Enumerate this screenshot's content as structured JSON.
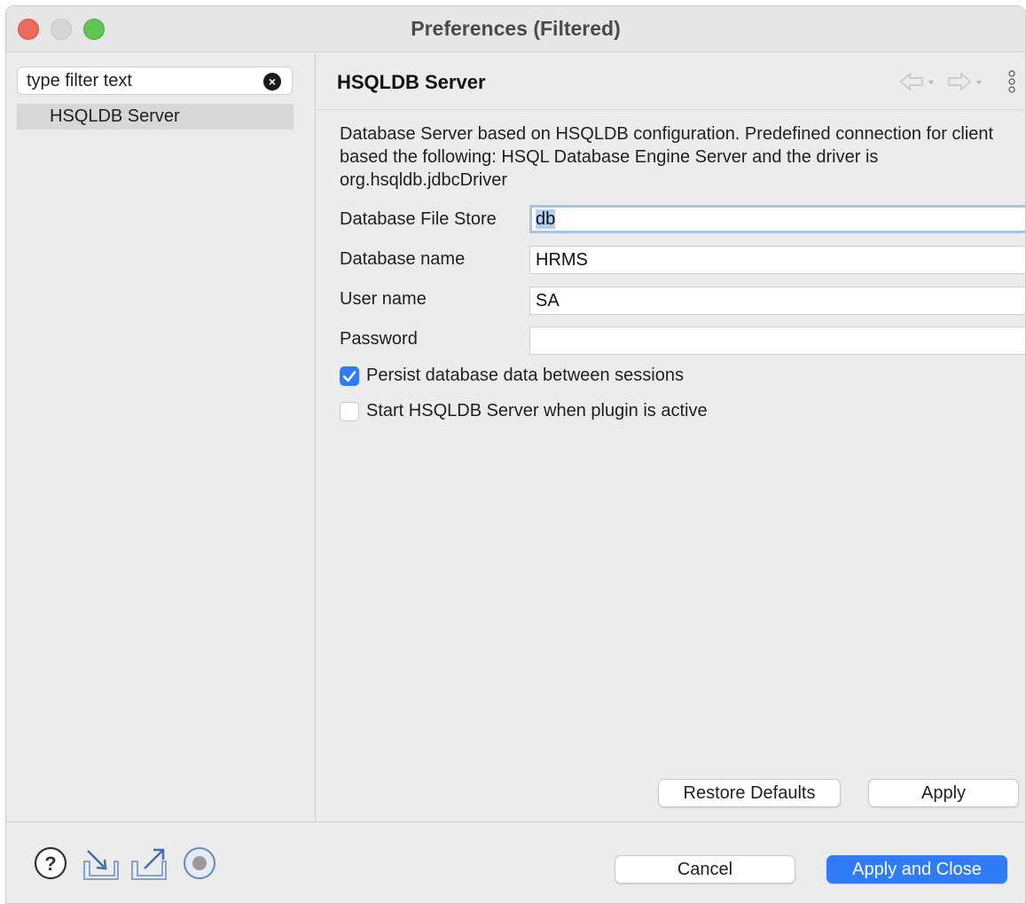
{
  "window": {
    "title": "Preferences (Filtered)"
  },
  "left_pane": {
    "filter_placeholder": "type filter text",
    "tree_items": [
      {
        "label": "HSQLDB Server",
        "selected": true
      }
    ]
  },
  "page": {
    "title": "HSQLDB Server",
    "description": "Database Server based on HSQLDB  configuration. Predefined connection for client based the following: HSQL Database Engine Server and the driver is org.hsqldb.jdbcDriver",
    "fields": [
      {
        "label": "Database File Store",
        "value": "db",
        "focused": true
      },
      {
        "label": "Database name",
        "value": "HRMS"
      },
      {
        "label": "User name",
        "value": "SA"
      },
      {
        "label": "Password",
        "value": ""
      }
    ],
    "checkboxes": [
      {
        "label": "Persist database data between sessions",
        "checked": true
      },
      {
        "label": "Start HSQLDB Server when plugin is active",
        "checked": false
      }
    ],
    "restore_defaults_label": "Restore Defaults",
    "apply_label": "Apply"
  },
  "footer": {
    "cancel_label": "Cancel",
    "apply_close_label": "Apply and Close",
    "icons": [
      "help-icon",
      "import-icon",
      "export-icon",
      "record-icon"
    ]
  },
  "colors": {
    "accent": "#2f7cf6",
    "close": "#ed6a5e",
    "minimize": "#d6d6d6",
    "maximize": "#61c554"
  }
}
